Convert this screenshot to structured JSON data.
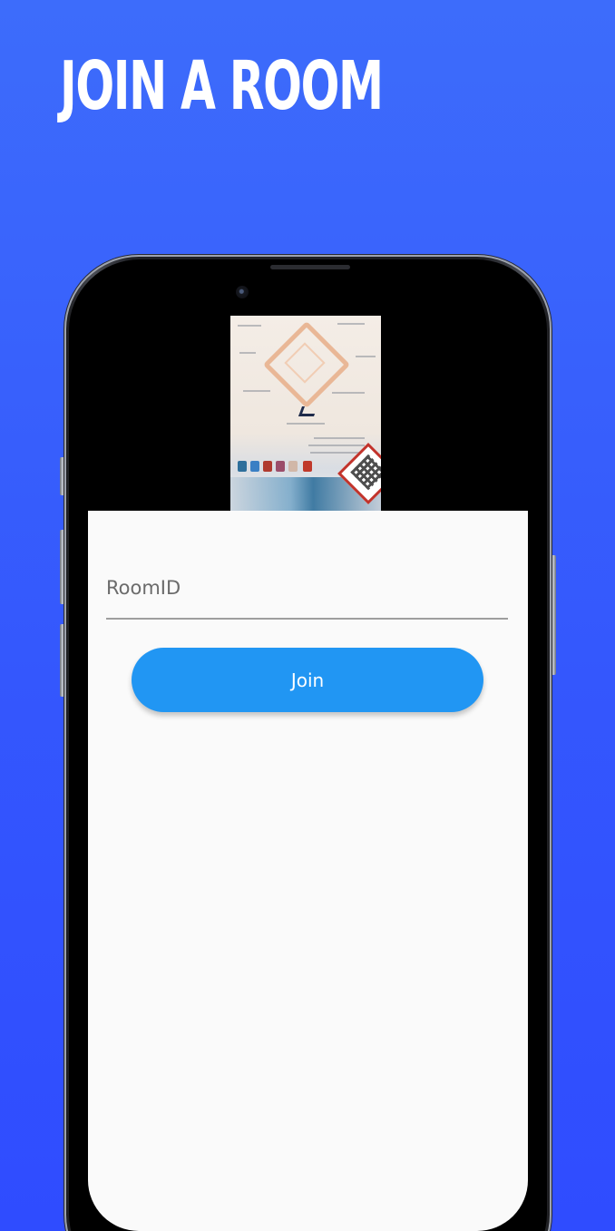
{
  "header": {
    "title": "JOIN A ROOM"
  },
  "form": {
    "room_id_placeholder": "RoomID",
    "room_id_value": "",
    "join_label": "Join"
  },
  "theme": {
    "background_top": "#3d6cfb",
    "background_bottom": "#2f4cff",
    "button_color": "#2196f3",
    "screen_color": "#fafafa"
  },
  "icons": {
    "camera": "front-camera-icon",
    "speaker": "speaker-grille-icon"
  }
}
